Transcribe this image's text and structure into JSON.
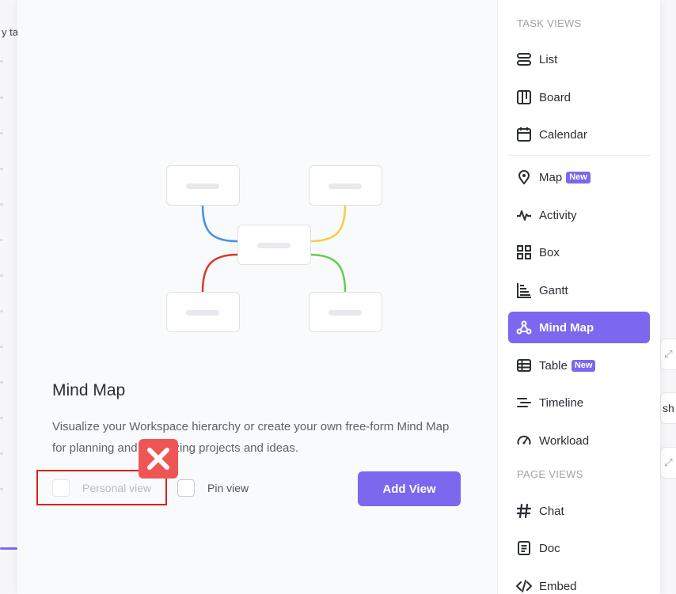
{
  "background": {
    "text": "y ta",
    "chip_text": "sh"
  },
  "modal": {
    "title": "Mind Map",
    "description": "Visualize your Workspace hierarchy or create your own free-form Mind Map for planning and organizing projects and ideas.",
    "personal_view_label": "Personal view",
    "pin_view_label": "Pin view",
    "add_view_label": "Add View"
  },
  "sidebar": {
    "task_views_label": "TASK VIEWS",
    "page_views_label": "PAGE VIEWS",
    "new_badge": "New",
    "items": [
      {
        "label": "List",
        "icon": "list-icon"
      },
      {
        "label": "Board",
        "icon": "board-icon"
      },
      {
        "label": "Calendar",
        "icon": "calendar-icon"
      },
      {
        "label": "Map",
        "icon": "map-pin-icon",
        "badge": "New"
      },
      {
        "label": "Activity",
        "icon": "activity-icon"
      },
      {
        "label": "Box",
        "icon": "box-grid-icon"
      },
      {
        "label": "Gantt",
        "icon": "gantt-icon"
      },
      {
        "label": "Mind Map",
        "icon": "mind-map-icon",
        "active": true
      },
      {
        "label": "Table",
        "icon": "table-icon",
        "badge": "New"
      },
      {
        "label": "Timeline",
        "icon": "timeline-icon"
      },
      {
        "label": "Workload",
        "icon": "workload-gauge-icon"
      }
    ],
    "page_items": [
      {
        "label": "Chat",
        "icon": "hash-icon"
      },
      {
        "label": "Doc",
        "icon": "doc-icon"
      },
      {
        "label": "Embed",
        "icon": "code-icon"
      }
    ]
  },
  "colors": {
    "accent": "#7b68ee",
    "branch_blue": "#4a8fe8",
    "branch_yellow": "#f5cd47",
    "branch_red": "#d93a2b",
    "branch_green": "#6bc950",
    "highlight_red": "#e0211b"
  }
}
